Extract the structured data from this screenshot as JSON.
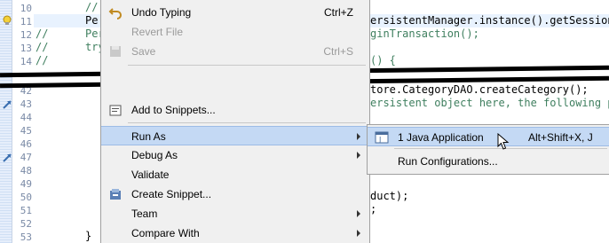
{
  "editor": {
    "line_numbers": [
      "10",
      "11",
      "12",
      "13",
      "14",
      "42",
      "43",
      "44",
      "45",
      "46",
      "47",
      "48",
      "49",
      "50",
      "51",
      "52",
      "53"
    ],
    "code_lines": {
      "l10": "//",
      "l11_prefix": "Pe",
      "l11_suffix": "ersistentManager.instance().getSession",
      "l12_comment": "//",
      "l12_a": "Per",
      "l12_b": "ginTransaction();",
      "l13_comment": "//",
      "l13_a": "try",
      "l14_comment": "//",
      "l14_b": "() {",
      "l42": "tore.CategoryDAO.createCategory();",
      "l43": "ersistent object here, the following pr",
      "l50": "duct);",
      "l51": ";",
      "l53": "}"
    }
  },
  "context_menu": {
    "items": [
      {
        "label": "Undo Typing",
        "shortcut": "Ctrl+Z",
        "icon": "undo-icon",
        "enabled": true
      },
      {
        "label": "Revert File",
        "shortcut": "",
        "enabled": false
      },
      {
        "label": "Save",
        "shortcut": "Ctrl+S",
        "icon": "save-icon",
        "enabled": false
      },
      {
        "label": "Add to Snippets...",
        "icon": "snippet-icon",
        "enabled": true
      },
      {
        "label": "Run As",
        "submenu": true,
        "enabled": true
      },
      {
        "label": "Debug As",
        "submenu": true,
        "enabled": true
      },
      {
        "label": "Validate",
        "enabled": true
      },
      {
        "label": "Create Snippet...",
        "icon": "create-snippet-icon",
        "enabled": true
      },
      {
        "label": "Team",
        "submenu": true,
        "enabled": true
      },
      {
        "label": "Compare With",
        "submenu": true,
        "enabled": true
      }
    ]
  },
  "run_as_submenu": {
    "items": [
      {
        "label": "1 Java Application",
        "shortcut": "Alt+Shift+X, J",
        "icon": "java-app-icon"
      },
      {
        "label": "Run Configurations..."
      }
    ]
  },
  "colors": {
    "menu_bg": "#f0f0f0",
    "selection": "#c4d9f4",
    "comment": "#3f7f5f"
  }
}
